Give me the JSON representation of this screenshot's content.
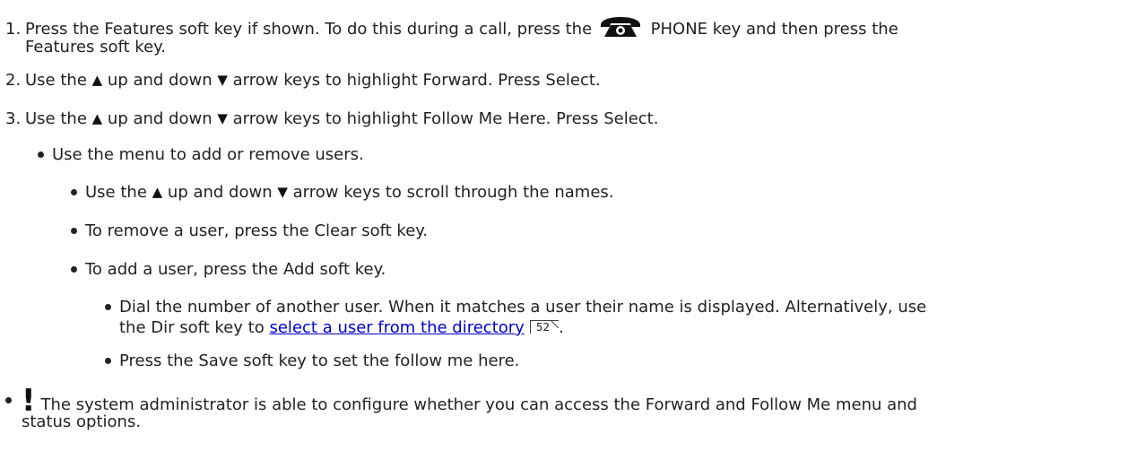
{
  "steps": [
    {
      "number": "1.",
      "prefix": "Press the Features soft key if shown. To do this during a call, press the",
      "key_label": "PHONE key and then press the",
      "continuation": "Features soft key."
    },
    {
      "number": "2.",
      "before": "Use the",
      "middle": "up and down",
      "after": "arrow keys to highlight Forward. Press Select."
    },
    {
      "number": "3.",
      "before": "Use the",
      "middle": "up and down",
      "after": "arrow keys to highlight Follow Me Here. Press Select."
    }
  ],
  "menu_bullet": "Use the menu to add or remove users.",
  "sub_bullets": {
    "scroll_before": "Use the",
    "scroll_middle": "up and down",
    "scroll_after": "arrow keys to scroll through the names.",
    "remove": "To remove a user, press the Clear soft key.",
    "add": "To add a user, press the Add soft key."
  },
  "sub_sub_bullets": {
    "dial_line1": "Dial the number of another user. When it matches a user their name is displayed.  Alternatively, use",
    "dial_line2_before": "the Dir soft key to",
    "dial_link": "select a user from the directory",
    "dial_page_ref": "52",
    "dial_line2_after": ".",
    "save": "Press the Save soft key to set the follow me here."
  },
  "note": {
    "mark": "!",
    "line1": "The system administrator is able to configure whether you can access the Forward and Follow Me menu and",
    "line2": "status options."
  },
  "icons": {
    "phone": "phone-handset-icon",
    "up": "up-arrow-icon",
    "down": "down-arrow-icon",
    "page_ref": "page-reference-icon",
    "note": "exclamation-icon"
  }
}
